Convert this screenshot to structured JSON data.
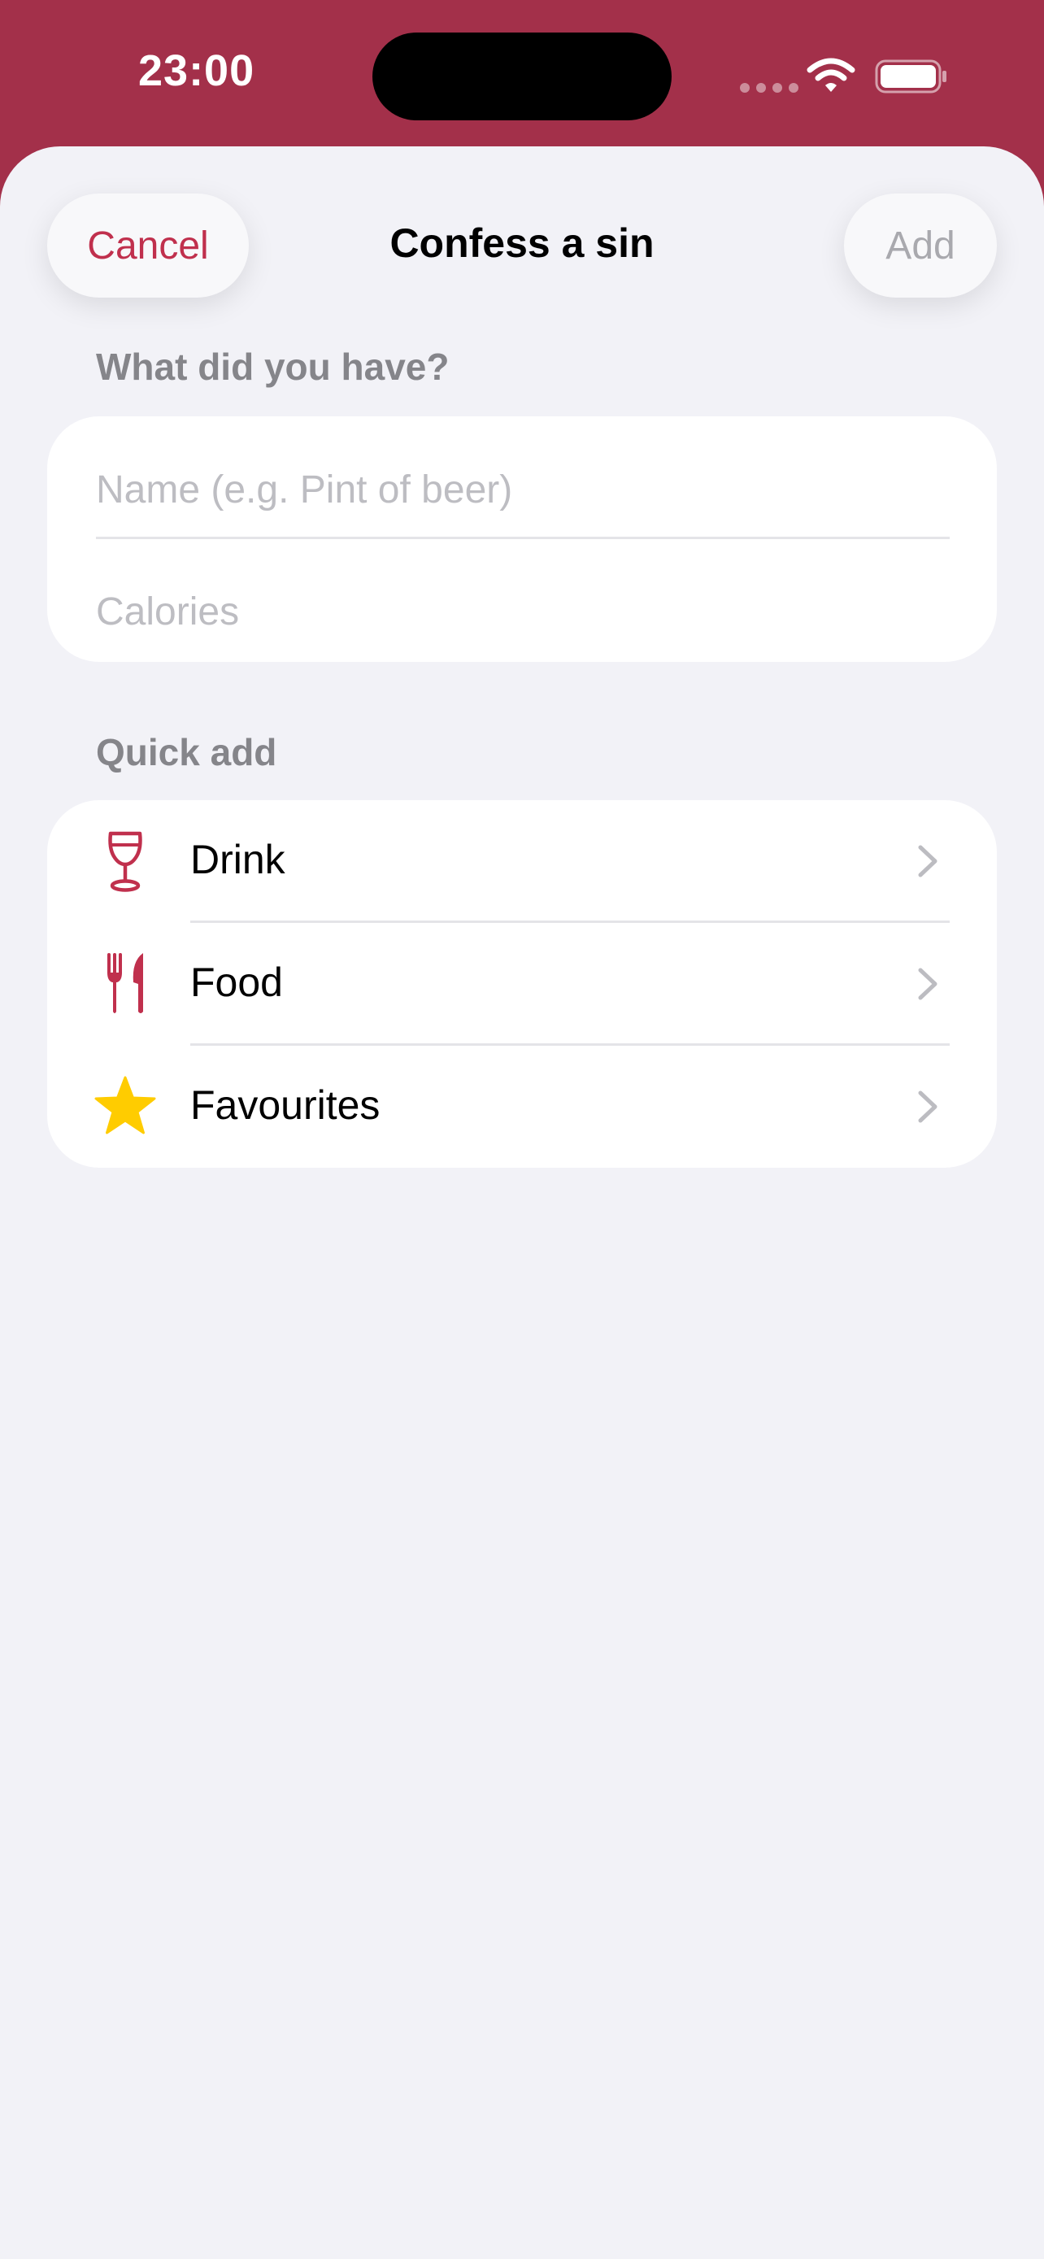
{
  "status_bar": {
    "time": "23:00",
    "icons": [
      "signal-dots-icon",
      "wifi-icon",
      "battery-icon"
    ]
  },
  "header": {
    "cancel_label": "Cancel",
    "title": "Confess a sin",
    "add_label": "Add"
  },
  "form": {
    "section_title": "What did you have?",
    "name_placeholder": "Name (e.g. Pint of beer)",
    "name_value": "",
    "calories_placeholder": "Calories",
    "calories_value": ""
  },
  "quick_add": {
    "section_title": "Quick add",
    "items": [
      {
        "label": "Drink",
        "icon": "wine-glass-icon"
      },
      {
        "label": "Food",
        "icon": "fork-knife-icon"
      },
      {
        "label": "Favourites",
        "icon": "star-icon"
      }
    ]
  },
  "colors": {
    "accent": "#C0304D",
    "brand_background": "#A3304A",
    "sheet_background": "#F2F2F7",
    "star": "#FFCC00",
    "disabled_text": "#A9A9AE",
    "secondary_text": "#85858A"
  }
}
